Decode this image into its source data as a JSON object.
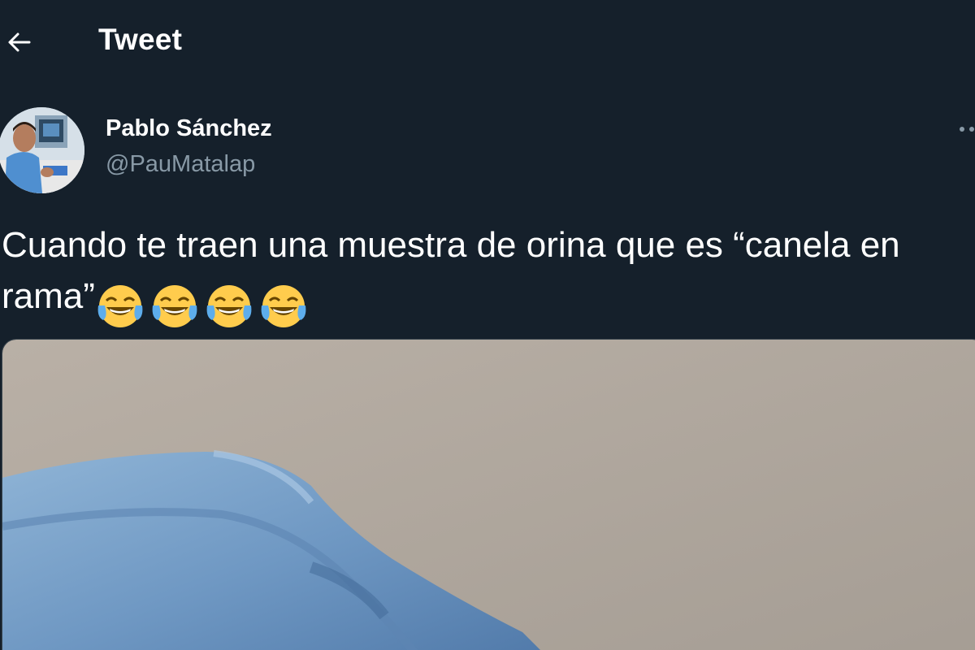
{
  "header": {
    "title": "Tweet",
    "back_icon": "arrow-left-icon"
  },
  "author": {
    "name": "Pablo Sánchez",
    "handle": "@PauMatalap",
    "avatar_icon": "avatar-photo"
  },
  "tweet": {
    "text": "Cuando te traen una muestra de orina que es “canela en rama”",
    "emoji_icon": "face-with-tears-of-joy-icon",
    "emoji_count": 4
  },
  "colors": {
    "background": "#15202b",
    "secondary_text": "#8899a6"
  }
}
